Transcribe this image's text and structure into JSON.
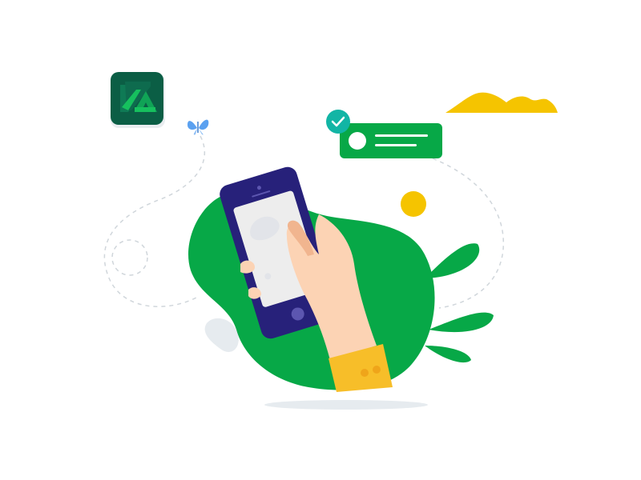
{
  "illustration": {
    "icons": [
      "app-logo-icon",
      "butterfly-icon",
      "checkmark-icon",
      "smartphone-icon",
      "hand-icon",
      "mountain-icon",
      "sun-icon"
    ]
  },
  "colors": {
    "green": "#07A847",
    "dark_green": "#0B5E45",
    "phone_navy": "#27217A",
    "screen": "#EDEDED",
    "skin": "#FCD3B4",
    "skin_shadow": "#F1B58F",
    "sleeve": "#F7BE29",
    "yellow": "#F5C400",
    "teal": "#12B5A5",
    "butterfly_blue": "#5BA1F0",
    "dash": "#D0D6DB",
    "shadow": "#E6EBEF",
    "white": "#FFFFFF"
  }
}
